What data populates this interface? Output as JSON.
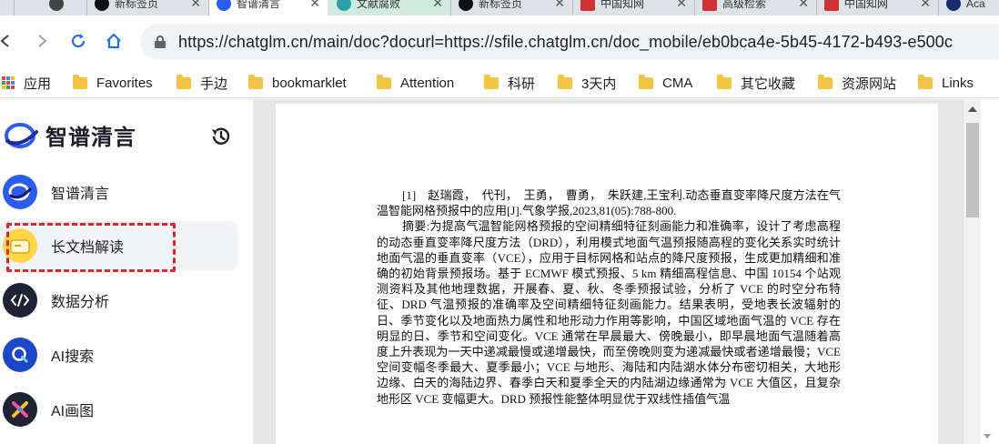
{
  "tabs": [
    {
      "title": "新标签页",
      "active": false
    },
    {
      "title": "",
      "active": false
    },
    {
      "title": "新标签页",
      "active": false
    },
    {
      "title": "智谱清言",
      "active": true
    },
    {
      "title": "文献腐败",
      "active": false
    },
    {
      "title": "新标签页",
      "active": false
    },
    {
      "title": "中国知网",
      "active": false
    },
    {
      "title": "高级检索",
      "active": false
    },
    {
      "title": "中国知网",
      "active": false
    },
    {
      "title": "Aca",
      "active": false
    }
  ],
  "address_bar": {
    "url": "https://chatglm.cn/main/doc?docurl=https://sfile.chatglm.cn/doc_mobile/eb0bca4e-5b45-4172-b493-e500c"
  },
  "bookmarks": [
    {
      "label": "应用",
      "icon": "apps-grid-icon"
    },
    {
      "label": "Favorites",
      "icon": "folder-icon"
    },
    {
      "label": "手边",
      "icon": "folder-icon"
    },
    {
      "label": "bookmarklet",
      "icon": "folder-icon"
    },
    {
      "label": "Attention",
      "icon": "folder-icon"
    },
    {
      "label": "科研",
      "icon": "folder-icon"
    },
    {
      "label": "3天内",
      "icon": "folder-icon"
    },
    {
      "label": "CMA",
      "icon": "folder-icon"
    },
    {
      "label": "其它收藏",
      "icon": "folder-icon"
    },
    {
      "label": "资源网站",
      "icon": "folder-icon"
    },
    {
      "label": "Links",
      "icon": "folder-icon"
    }
  ],
  "sidebar": {
    "logo_text": "智谱清言",
    "items": [
      {
        "label": "智谱清言",
        "icon": "chatglm-logo-icon",
        "selected": false
      },
      {
        "label": "长文档解读",
        "icon": "document-folder-icon",
        "selected": true
      },
      {
        "label": "数据分析",
        "icon": "code-icon",
        "selected": false
      },
      {
        "label": "AI搜索",
        "icon": "search-q-icon",
        "selected": false
      },
      {
        "label": "AI画图",
        "icon": "painting-x-icon",
        "selected": false
      }
    ]
  },
  "document": {
    "reference": "[1]　赵瑞霞，　代刊，　王勇，　曹勇，　朱跃建,王宝利.动态垂直变率降尺度方法在气温智能网格预报中的应用[J].气象学报,2023,81(05):788-800.",
    "abstract": "摘要:为提高气温智能网格预报的空间精细特征刻画能力和准确率，设计了考虑高程的动态垂直变率降尺度方法（DRD），利用模式地面气温预报随高程的变化关系实时统计地面气温的垂直变率（VCE），应用于目标网格和站点的降尺度预报，生成更加精细和准确的初始背景预报场。基于 ECMWF 模式预报、5 km 精细高程信息、中国 10154 个站观测资料及其他地理数据，开展春、夏、秋、冬季预报试验，分析了 VCE 的时空分布特征、DRD 气温预报的准确率及空间精细特征刻画能力。结果表明，受地表长波辐射的日、季节变化以及地面热力属性和地形动力作用等影响，中国区域地面气温的 VCE 存在明显的日、季节和空间变化。VCE 通常在早晨最大、傍晚最小，即早晨地面气温随着高度上升表现为一天中递减最慢或递增最快，而至傍晚则变为递减最快或者递增最慢；VCE 空间变幅冬季最大、夏季最小；VCE 与地形、海陆和内陆湖水体分布密切相关，大地形边缘、白天的海陆边界、春季白天和夏季全天的内陆湖边缘通常为 VCE 大值区，且复杂地形区 VCE 变幅更大。DRD 预报性能整体明显优于双线性插值气温"
  },
  "colors": {
    "highlight_border": "#e8222a",
    "brand_blue": "#2b5cf0",
    "selected_bg": "#f2f3f7"
  }
}
